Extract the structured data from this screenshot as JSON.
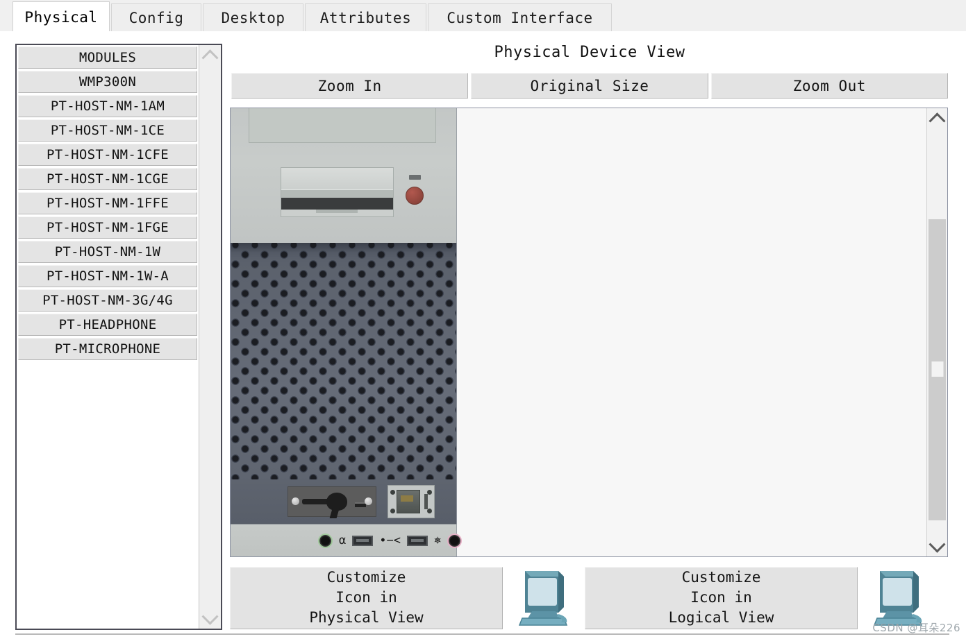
{
  "tabs": [
    {
      "label": "Physical",
      "active": true
    },
    {
      "label": "Config",
      "active": false
    },
    {
      "label": "Desktop",
      "active": false
    },
    {
      "label": "Attributes",
      "active": false
    },
    {
      "label": "Custom Interface",
      "active": false
    }
  ],
  "modules": {
    "header": "MODULES",
    "items": [
      "MODULES",
      "WMP300N",
      "PT-HOST-NM-1AM",
      "PT-HOST-NM-1CE",
      "PT-HOST-NM-1CFE",
      "PT-HOST-NM-1CGE",
      "PT-HOST-NM-1FFE",
      "PT-HOST-NM-1FGE",
      "PT-HOST-NM-1W",
      "PT-HOST-NM-1W-A",
      "PT-HOST-NM-3G/4G",
      "PT-HEADPHONE",
      "PT-MICROPHONE"
    ]
  },
  "device_view": {
    "title": "Physical Device View",
    "zoom_in": "Zoom In",
    "original_size": "Original Size",
    "zoom_out": "Zoom Out"
  },
  "customize": {
    "physical": {
      "line1": "Customize",
      "line2": "Icon in",
      "line3": "Physical View"
    },
    "logical": {
      "line1": "Customize",
      "line2": "Icon in",
      "line3": "Logical View"
    }
  },
  "watermark": "CSDN @耳朵226",
  "colors": {
    "panel_bg": "#f0f0f0",
    "button_face": "#e3e3e3",
    "active_tab": "#ffffff",
    "canvas": "#f7f7f7",
    "chassis_light": "#c3c7c6",
    "chassis_mesh": "#5e646f",
    "power_button": "#8e453c",
    "icon_teal": "#5e97a8"
  }
}
